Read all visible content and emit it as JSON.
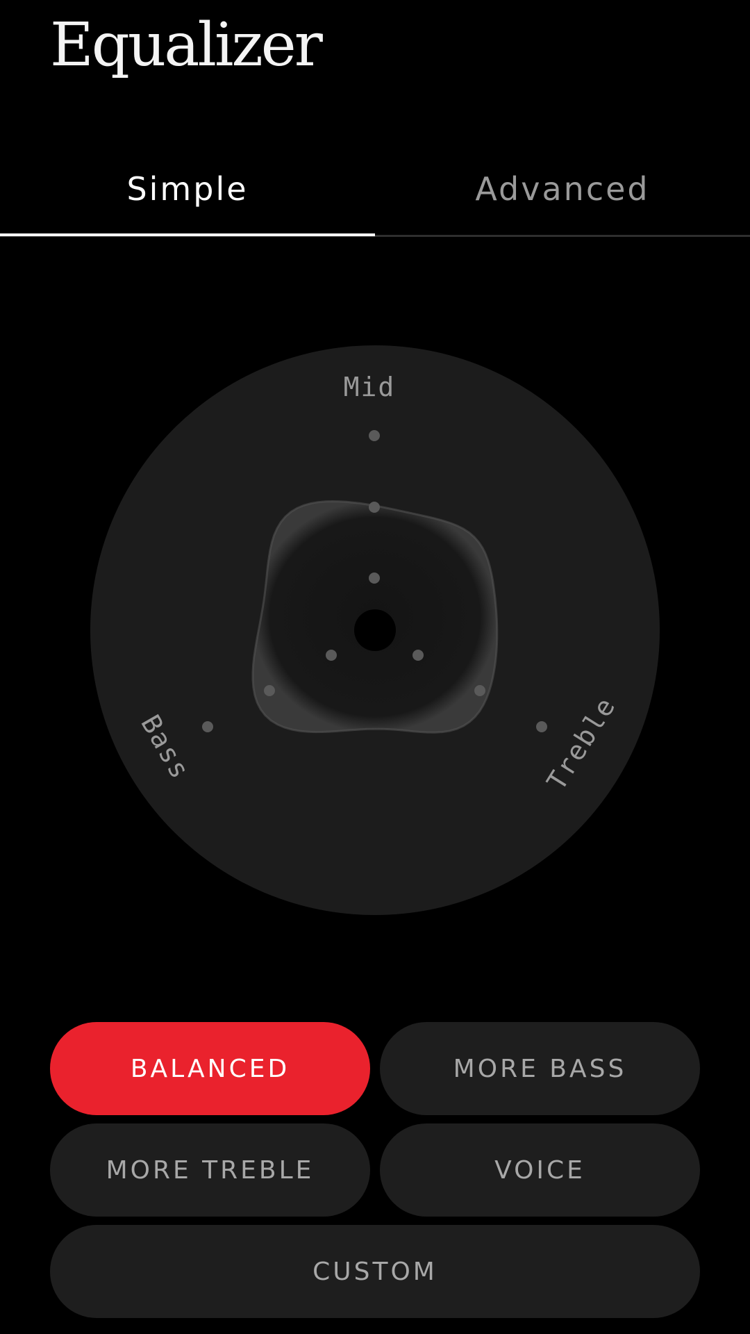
{
  "header": {
    "title": "Equalizer"
  },
  "tabs": [
    {
      "label": "Simple",
      "active": true
    },
    {
      "label": "Advanced",
      "active": false
    }
  ],
  "equalizer": {
    "labels": {
      "mid": "Mid",
      "bass": "Bass",
      "treble": "Treble"
    },
    "levels": {
      "mid": 0.5,
      "bass": 0.5,
      "treble": 0.5
    }
  },
  "presets": [
    {
      "label": "BALANCED",
      "active": true
    },
    {
      "label": "MORE BASS",
      "active": false
    },
    {
      "label": "MORE TREBLE",
      "active": false
    },
    {
      "label": "VOICE",
      "active": false
    },
    {
      "label": "CUSTOM",
      "active": false
    }
  ],
  "colors": {
    "background": "#000000",
    "dial": "#1c1c1c",
    "accent": "#ea222d",
    "button": "#1e1e1e"
  }
}
